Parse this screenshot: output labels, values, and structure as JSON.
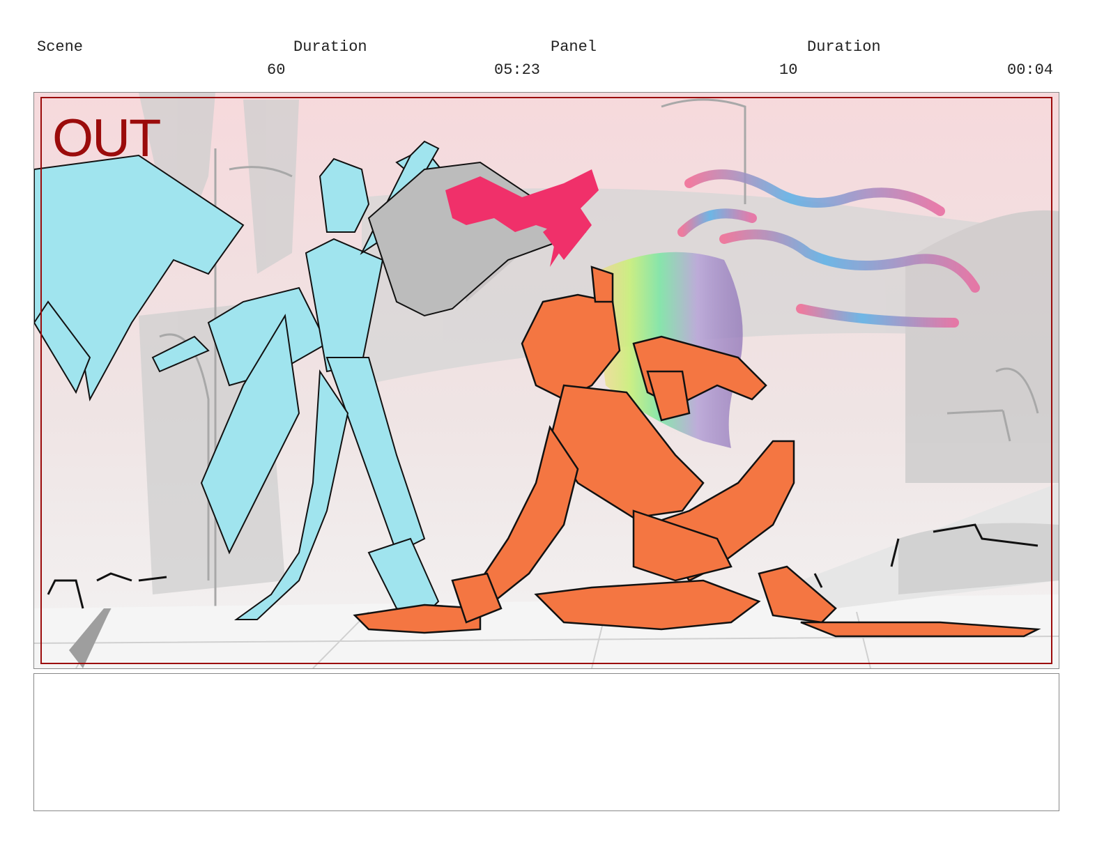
{
  "header": {
    "scene_label": "Scene",
    "scene_value": "60",
    "scene_duration_label": "Duration",
    "scene_duration_value": "05:23",
    "panel_label": "Panel",
    "panel_value": "10",
    "panel_duration_label": "Duration",
    "panel_duration_value": "00:04"
  },
  "panel": {
    "overlay_text": "OUT",
    "colors": {
      "safe_frame": "#9b0b0b",
      "figure_left": "#a0e4ee",
      "figure_right": "#f47642",
      "slash_effect": "#f0306a"
    }
  },
  "notes": {
    "text": ""
  }
}
